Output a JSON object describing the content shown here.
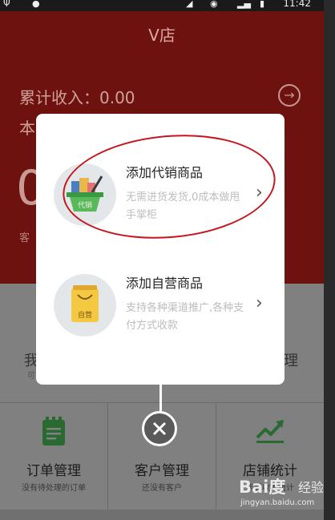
{
  "app": {
    "title": "V店"
  },
  "status_bar": {
    "time": "11:42"
  },
  "dashboard": {
    "income_label": "累计收入：0.00",
    "partial_label": "本",
    "big_number": "0",
    "customer_partial": "客",
    "my_partial": "我",
    "my_sub_partial": "可",
    "manage_partial": "理"
  },
  "tiles": [
    {
      "name": "订单管理",
      "sub": "没有待处理的订单",
      "icon": "clipboard-icon"
    },
    {
      "name": "客户管理",
      "sub": "还没有客户",
      "icon": "people-icon"
    },
    {
      "name": "店铺统计",
      "sub": "店铺收入统计",
      "icon": "chart-icon"
    }
  ],
  "popup": {
    "options": [
      {
        "title": "添加代销商品",
        "description": "无需进货发货,0成本做甩手掌柜",
        "icon": "basket-icon",
        "icon_label": "代销"
      },
      {
        "title": "添加自营商品",
        "description": "支持各种渠道推广,各种支付方式收款",
        "icon": "bag-icon",
        "icon_label": "自营"
      }
    ],
    "close_icon": "close-icon"
  },
  "watermark": {
    "logo": "Bai度",
    "brand": "经验",
    "url": "jingyan.baidu.com"
  },
  "colors": {
    "header_red": "#c0201a",
    "accent_green": "#3aa84a",
    "highlight_red": "#c4161c"
  }
}
